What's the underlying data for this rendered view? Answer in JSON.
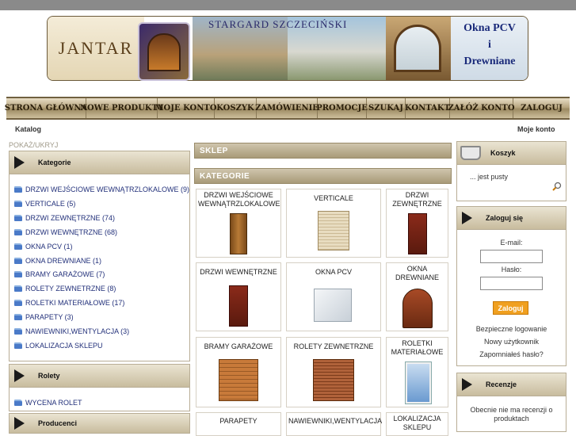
{
  "banner": {
    "logo_text": "JANTAR",
    "title": "STARGARD SZCZECIŃSKI",
    "tagline_line1": "Okna PCV",
    "tagline_line2": "i",
    "tagline_line3": "Drewniane"
  },
  "nav": {
    "items": [
      "STRONA GŁÓWNA",
      "NOWE PRODUKTY",
      "MOJE KONTO",
      "KOSZYK",
      "ZAMÓWIENIE",
      "PROMOCJE",
      "SZUKAJ",
      "KONTAKT",
      "ZAŁÓŻ KONTO",
      "ZALOGUJ"
    ]
  },
  "breadcrumb": {
    "left": "Katalog",
    "right": "Moje konto"
  },
  "left": {
    "toggle": "POKAŻ/UKRYJ",
    "categories_title": "Kategorie",
    "categories": [
      "DRZWI WEJŚCIOWE WEWNĄTRZLOKALOWE (9)",
      "VERTICALE (5)",
      "DRZWI ZEWNĘTRZNE (74)",
      "DRZWI WEWNĘTRZNE (68)",
      "OKNA PCV (1)",
      "OKNA DREWNIANE (1)",
      "BRAMY GARAŻOWE (7)",
      "ROLETY ZEWNETRZNE (8)",
      "ROLETKI MATERIAŁOWE (17)",
      "PARAPETY (3)",
      "NAWIEWNIKI,WENTYLACJA (3)",
      "LOKALIZACJA SKLEPU"
    ],
    "rolety_title": "Rolety",
    "rolety_items": [
      "WYCENA ROLET"
    ],
    "producers_title": "Producenci"
  },
  "center": {
    "shop_label": "SKLEP",
    "categories_label": "KATEGORIE",
    "tiles": [
      {
        "label": "DRZWI WEJŚCIOWE WEWNĄTRZLOKALOWE"
      },
      {
        "label": "VERTICALE"
      },
      {
        "label": "DRZWI ZEWNĘTRZNE"
      },
      {
        "label": "DRZWI WEWNĘTRZNE"
      },
      {
        "label": "OKNA PCV"
      },
      {
        "label": "OKNA DREWNIANE"
      },
      {
        "label": "BRAMY GARAŻOWE"
      },
      {
        "label": "ROLETY ZEWNETRZNE"
      },
      {
        "label": "ROLETKI MATERIAŁOWE"
      },
      {
        "label": "PARAPETY"
      },
      {
        "label": "NAWIEWNIKI,WENTYLACJA"
      },
      {
        "label": "LOKALIZACJA SKLEPU"
      }
    ]
  },
  "right": {
    "cart_title": "Koszyk",
    "cart_empty": "... jest pusty",
    "login_title": "Zaloguj się",
    "email_label": "E-mail:",
    "password_label": "Hasło:",
    "login_button": "Zaloguj",
    "secure_login": "Bezpieczne logowanie",
    "new_user": "Nowy użytkownik",
    "forgot_password": "Zapomniałeś hasło?",
    "reviews_title": "Recenzje",
    "reviews_empty": "Obecnie nie ma recenzji o produktach"
  },
  "colors": {
    "accent": "#f0a020",
    "link": "#22307a",
    "nav_bg": "#b8a680"
  }
}
